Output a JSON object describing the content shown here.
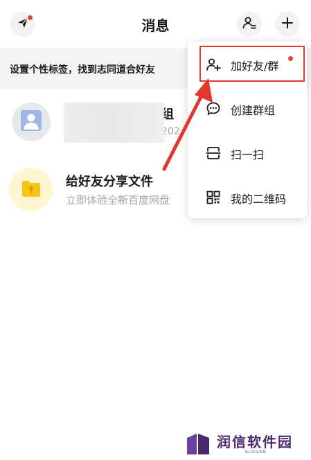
{
  "header": {
    "title": "消息",
    "accent_dot_color": "#e8463c"
  },
  "banner": {
    "text": "设置个性标签，找到志同道合好友"
  },
  "conversations": [
    {
      "id": "group",
      "avatar_icon": "person-placeholder-icon",
      "title_visible": "组",
      "subtitle_visible": "202"
    },
    {
      "id": "share",
      "avatar_icon": "folder-upload-icon",
      "title": "给好友分享文件",
      "subtitle": "立即体验全新百度网盘"
    }
  ],
  "menu": {
    "items": [
      {
        "label": "加好友/群",
        "icon": "add-person-icon",
        "highlighted": true,
        "has_dot": true
      },
      {
        "label": "创建群组",
        "icon": "chat-bubble-icon",
        "highlighted": false,
        "has_dot": false
      },
      {
        "label": "扫一扫",
        "icon": "scan-icon",
        "highlighted": false,
        "has_dot": false
      },
      {
        "label": "我的二维码",
        "icon": "qr-code-icon",
        "highlighted": false,
        "has_dot": false
      }
    ]
  },
  "annotation": {
    "arrow_color": "#e1372f",
    "highlight_color": "#e1372f"
  },
  "watermark": {
    "text": "润信软件园",
    "slogan": "SLOGAN"
  }
}
